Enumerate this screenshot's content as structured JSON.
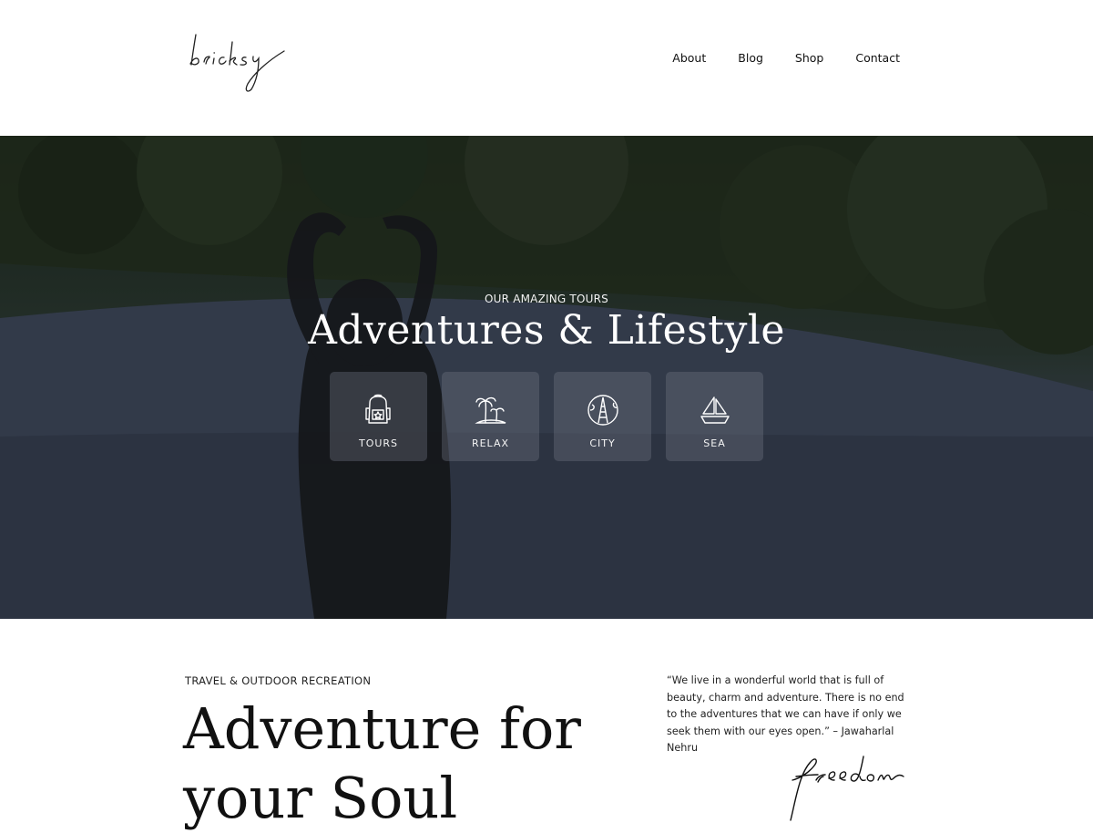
{
  "brand": {
    "logo_text": "bricksy"
  },
  "nav": {
    "items": [
      "About",
      "Blog",
      "Shop",
      "Contact"
    ]
  },
  "hero": {
    "subtitle": "OUR AMAZING TOURS",
    "title": "Adventures & Lifestyle",
    "cards": [
      {
        "label": "TOURS",
        "icon": "backpack-icon"
      },
      {
        "label": "RELAX",
        "icon": "palm-island-icon"
      },
      {
        "label": "CITY",
        "icon": "tower-globe-icon"
      },
      {
        "label": "SEA",
        "icon": "sailboat-icon"
      }
    ]
  },
  "section": {
    "kicker": "TRAVEL & OUTDOOR RECREATION",
    "heading_line1": "Adventure for",
    "heading_line2": "your Soul",
    "quote": "“We live in a wonderful world that is full of beauty, charm and adventure. There is no end to the adventures that we can have if only we seek them with our eyes open.” – Jawaharlal Nehru",
    "signature_text": "freedom"
  }
}
